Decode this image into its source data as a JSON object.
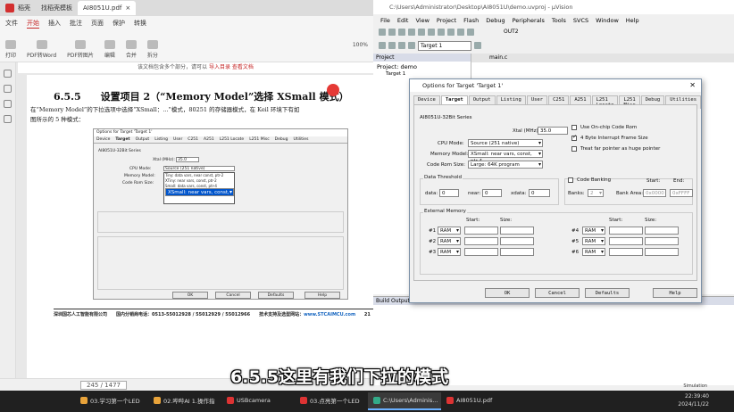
{
  "pdf": {
    "tabs": [
      "稻壳",
      "找稻壳模板",
      "AI8051U.pdf"
    ],
    "menu": [
      "文件",
      "开始",
      "插入",
      "批注",
      "页面",
      "保护",
      "转换"
    ],
    "menu_active": "开始",
    "ribbon": [
      "打印",
      "PDF转Word",
      "PDF转图片",
      "编辑",
      "合并",
      "拆分"
    ],
    "zoom": "100%",
    "notice_text": "该文档包含多个部分，请可以",
    "notice_link1": "导入目录",
    "notice_link2": "查看文档",
    "section_title": "6.5.5　　设置项目 2（“Memory Model”选择 XSmall 模式）",
    "body_line1": "在“Memory Model”的下拉选项中选择“XSmall：...”模式，80251 的存储器模式，在 Keil 环境下有如",
    "body_line2": "图所示的 5 种模式：",
    "small_dialog": {
      "title": "Options for Target 'Target 1'",
      "tabs": [
        "Device",
        "Target",
        "Output",
        "Listing",
        "User",
        "C251",
        "A251",
        "L251 Locate",
        "L251 Misc",
        "Debug",
        "Utilities"
      ],
      "device": "AI8051U-32Bit Series",
      "xtal_label": "Xtal (MHz):",
      "xtal": "35.0",
      "cpu_mode_label": "CPU Mode:",
      "cpu_mode": "Source (251 native)",
      "memory_model_label": "Memory Model:",
      "memory_model": "XSmall: near const, ptr-4",
      "code_rom_label": "Code Rom Size:",
      "options": [
        "Tiny: data vars, near const, ptr-2",
        "XTiny: near vars, const, ptr-2",
        "Small: data vars, const, ptr-4",
        "XSmall: near vars, const, ptr-4",
        "Large: xdata vars, const, ptr-4"
      ],
      "ok": "OK",
      "cancel": "Cancel",
      "defaults": "Defaults",
      "help": "Help"
    },
    "footer_text": "深圳国芯人工智能有限公司　　国内分销商电话：0513-55012928 / 55012929 / 55012966　　技术支持及选型网站：",
    "footer_link": "www.STCAIMCU.com",
    "page_num": "21",
    "page_indicator": "245 / 1477"
  },
  "keil": {
    "title": "C:\\Users\\Administrator\\Desktop\\AI8051U\\demo.uvproj - µVision",
    "menu": [
      "File",
      "Edit",
      "View",
      "Project",
      "Flash",
      "Debug",
      "Peripherals",
      "Tools",
      "SVCS",
      "Window",
      "Help"
    ],
    "toolbar_target": "Target 1",
    "toolbar_out": "OUT2",
    "project_header": "Project",
    "project_root": "Project: demo",
    "project_target": "Target 1",
    "editor_tab": "main.c",
    "build_header": "Build Output",
    "status": "Simulation"
  },
  "dialog": {
    "title": "Options for Target 'Target 1'",
    "close": "✕",
    "tabs": [
      "Device",
      "Target",
      "Output",
      "Listing",
      "User",
      "C251",
      "A251",
      "L251 Locate",
      "L251 Misc",
      "Debug",
      "Utilities"
    ],
    "active_tab": "Target",
    "device": "AI8051U-32Bit Series",
    "xtal_label": "Xtal (MHz):",
    "xtal": "35.0",
    "cpu_mode_label": "CPU Mode:",
    "cpu_mode": "Source (251 native)",
    "memory_model_label": "Memory Model:",
    "memory_model": "XSmall: near vars, const, ptr-4",
    "code_rom_label": "Code Rom Size:",
    "code_rom": "Large: 64K program",
    "onchip_code": "Use On-chip Code Rom",
    "intr_frame": "4 Byte Interrupt Frame Size",
    "far_ptr": "Treat far pointer as huge pointer",
    "data_threshold": "Data Threshold",
    "data_label": "data:",
    "data_val": "0",
    "near_label": "near:",
    "near_val": "0",
    "xdata_label": "xdata:",
    "xdata_val": "0",
    "code_banking": "Code Banking",
    "start": "Start:",
    "end": "End:",
    "banks_label": "Banks:",
    "banks_val": "2",
    "bank_area": "Bank Area:",
    "bank_start": "0x0000",
    "bank_end": "0xFFFF",
    "external_memory": "External Memory",
    "size": "Size:",
    "ext_rows": [
      "#1",
      "#2",
      "#3",
      "#4",
      "#5",
      "#6"
    ],
    "ram": "RAM",
    "ok": "OK",
    "cancel": "Cancel",
    "defaults": "Defaults",
    "help": "Help"
  },
  "subtitle": "6.5.5这里有我们下拉的模式",
  "taskbar": {
    "items": [
      "03.学习第一个LED",
      "02.哔哔AI 1.操作指",
      "USBcamera",
      "03.点亮第一个LED",
      "C:\\Users\\Adminis...",
      "AI8051U.pdf"
    ],
    "time": "22:39:40",
    "date": "2024/11/22"
  },
  "colors": {
    "accent_red": "#c62828",
    "task_active": "#6ab0ff",
    "selection": "#0055cc"
  }
}
